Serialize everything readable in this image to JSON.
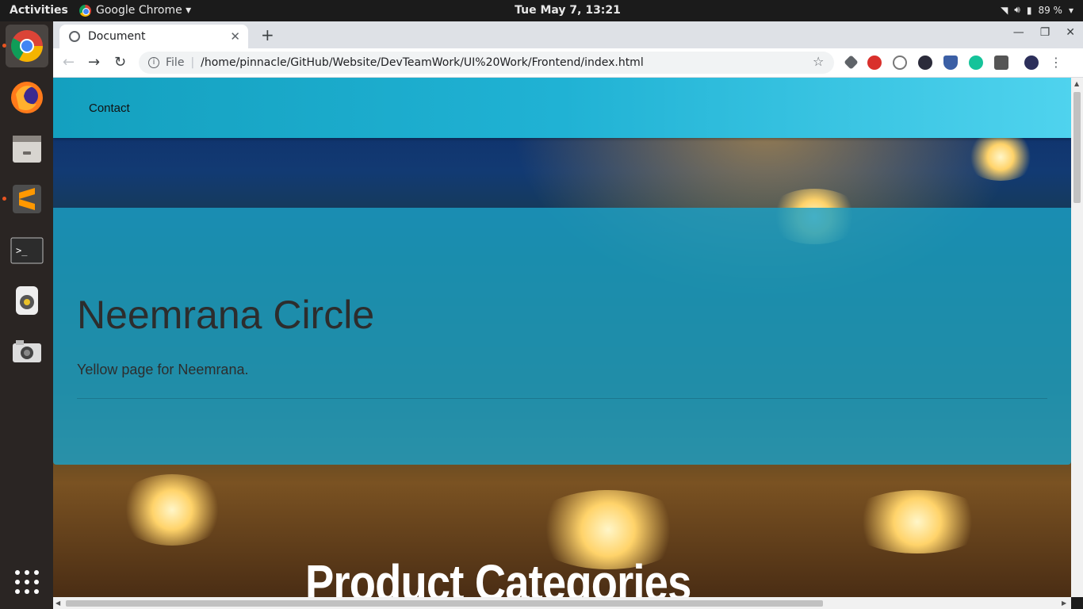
{
  "topbar": {
    "activities": "Activities",
    "app_name": "Google Chrome ▾",
    "clock": "Tue May  7, 13:21",
    "battery": "89 %"
  },
  "browser": {
    "tab_title": "Document",
    "url_scheme": "File",
    "url": "/home/pinnacle/GitHub/Website/DevTeamWork/UI%20Work/Frontend/index.html"
  },
  "page": {
    "nav_link": "Contact",
    "heading": "Neemrana Circle",
    "subtitle": "Yellow page for Neemrana.",
    "section_title": "Product Categories"
  },
  "dock": {
    "items": [
      "chrome-icon",
      "firefox-icon",
      "files-icon",
      "sublime-icon",
      "terminal-icon",
      "speaker-icon",
      "camera-icon",
      "apps-grid-icon"
    ]
  },
  "colors": {
    "navbar": "#20b2d4",
    "jumbotron": "#1ba0c6",
    "accent": "#e95420"
  }
}
